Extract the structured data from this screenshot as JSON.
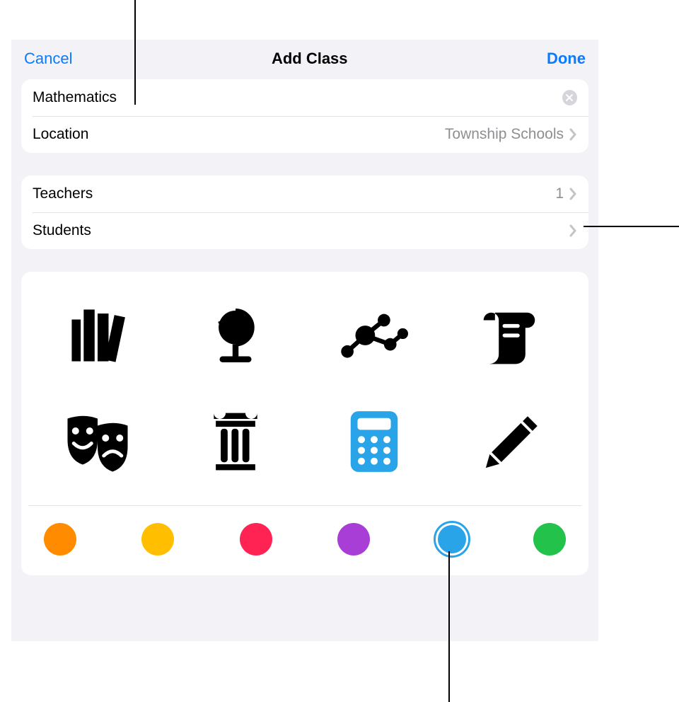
{
  "header": {
    "cancel_label": "Cancel",
    "title": "Add Class",
    "done_label": "Done"
  },
  "class_name": {
    "value": "Mathematics"
  },
  "location": {
    "label": "Location",
    "value": "Township Schools"
  },
  "teachers": {
    "label": "Teachers",
    "count": "1"
  },
  "students": {
    "label": "Students",
    "count": ""
  },
  "icons": [
    {
      "name": "books-icon",
      "selected": false
    },
    {
      "name": "globe-icon",
      "selected": false
    },
    {
      "name": "molecule-icon",
      "selected": false
    },
    {
      "name": "scroll-icon",
      "selected": false
    },
    {
      "name": "masks-icon",
      "selected": false
    },
    {
      "name": "column-icon",
      "selected": false
    },
    {
      "name": "calculator-icon",
      "selected": true
    },
    {
      "name": "pencil-icon",
      "selected": false
    }
  ],
  "colors": [
    {
      "name": "orange",
      "hex": "#ff8c00",
      "selected": false
    },
    {
      "name": "yellow",
      "hex": "#ffbf00",
      "selected": false
    },
    {
      "name": "pink",
      "hex": "#ff2354",
      "selected": false
    },
    {
      "name": "purple",
      "hex": "#a93ed6",
      "selected": false
    },
    {
      "name": "blue",
      "hex": "#29a4e8",
      "selected": true
    },
    {
      "name": "green",
      "hex": "#22c24b",
      "selected": false
    }
  ]
}
